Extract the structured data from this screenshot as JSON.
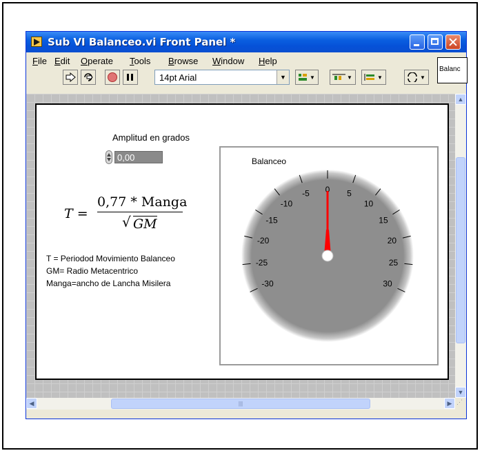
{
  "window": {
    "title": "Sub VI Balanceo.vi Front Panel *",
    "vi_icon_label": "Balanc"
  },
  "menu": {
    "items": [
      {
        "key": "file",
        "underline": "F",
        "rest": "ile"
      },
      {
        "key": "edit",
        "underline": "E",
        "rest": "dit"
      },
      {
        "key": "operate",
        "underline": "O",
        "rest": "perate"
      },
      {
        "key": "tools",
        "underline": "T",
        "rest": "ools"
      },
      {
        "key": "browse",
        "underline": "B",
        "rest": "rowse"
      },
      {
        "key": "window",
        "underline": "W",
        "rest": "indow"
      },
      {
        "key": "help",
        "underline": "H",
        "rest": "elp"
      }
    ]
  },
  "toolbar": {
    "font_value": "14pt Arial",
    "tools": [
      "run-arrow-icon",
      "run-continuously-icon",
      "abort-icon",
      "pause-icon",
      "align-icon",
      "distribute-icon",
      "resize-icon",
      "reorder-icon"
    ]
  },
  "panel": {
    "amplitude_label": "Amplitud en grados",
    "amplitude_value": "0,00",
    "formula": {
      "lhs": "T =",
      "numerator": "0,77 * Manga",
      "denominator": "GM"
    },
    "legend": [
      "T  = Periodod Movimiento Balanceo",
      "GM= Radio Metacentrico",
      "Manga=ancho de Lancha Misilera"
    ],
    "gauge": {
      "label": "Balanceo",
      "scale_min": -30,
      "scale_max": 30,
      "major_step": 5,
      "tick_labels": [
        "-30",
        "-25",
        "-20",
        "-15",
        "-10",
        "-5",
        "0",
        "5",
        "10",
        "15",
        "20",
        "25",
        "30"
      ],
      "value": 0,
      "needle_color": "#ff0000",
      "dial_color": "#8e8e8e"
    }
  },
  "colors": {
    "titlebar": "#0a5fe0",
    "window_frame": "#ece9d8",
    "scroll_thumb": "#c1d3fb"
  }
}
